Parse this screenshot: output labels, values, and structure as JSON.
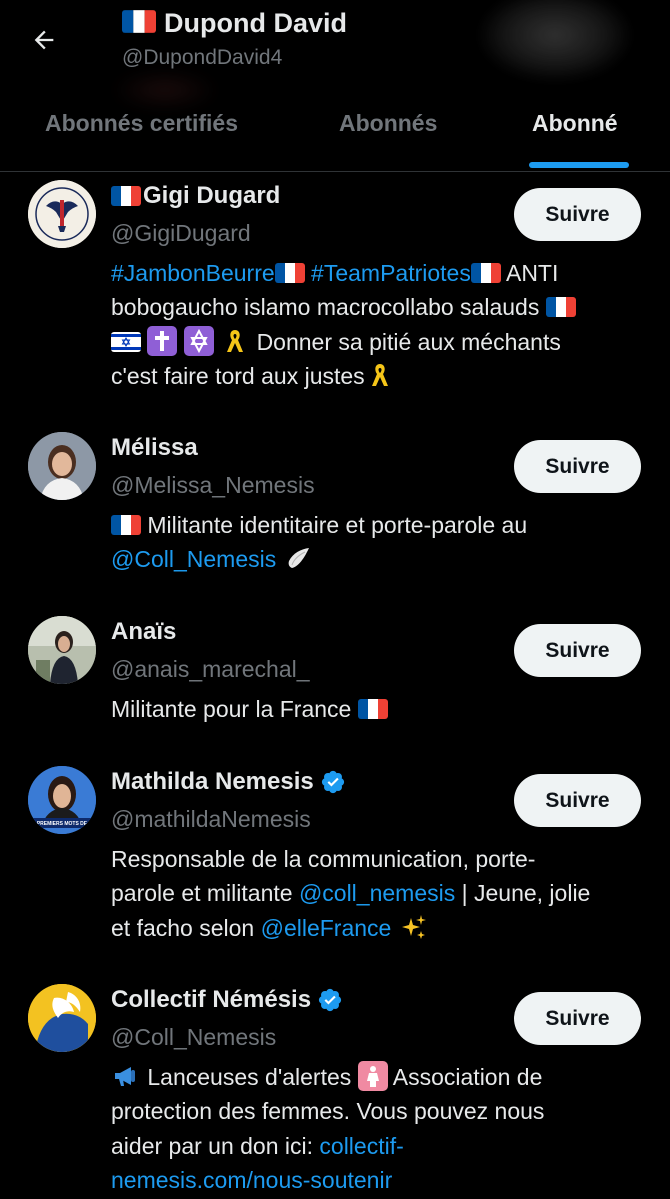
{
  "header": {
    "title": "Dupond David",
    "handle": "@DupondDavid4",
    "tabs": [
      {
        "label": "Abonnés certifiés",
        "active": false
      },
      {
        "label": "Abonnés",
        "active": false
      },
      {
        "label": "Abonné",
        "active": true
      }
    ]
  },
  "users": [
    {
      "name": "Gigi Dugard",
      "handle": "@GigiDugard",
      "follow_label": "Suivre",
      "bio": {
        "tag1": "#JambonBeurre",
        "tag2": "#TeamPatriotes",
        "text1": "ANTI",
        "text2": "bobogaucho islamo macrocollabo salauds",
        "text3": "Donner sa pitié aux méchants",
        "text4": "c'est faire tord aux justes"
      }
    },
    {
      "name": "Mélissa",
      "handle": "@Melissa_Nemesis",
      "follow_label": "Suivre",
      "bio": {
        "text1": "Militante identitaire et porte-parole au",
        "mention": "@Coll_Nemesis"
      }
    },
    {
      "name": "Anaïs",
      "handle": "@anais_marechal_",
      "follow_label": "Suivre",
      "bio": {
        "text1": "Militante pour la France"
      }
    },
    {
      "name": "Mathilda Nemesis",
      "handle": "@mathildaNemesis",
      "follow_label": "Suivre",
      "bio": {
        "text1": "Responsable de la communication, porte-",
        "text2": "parole et militante",
        "mention1": "@coll_nemesis",
        "text3": "| Jeune, jolie",
        "text4": "et facho selon",
        "mention2": "@elleFrance"
      }
    },
    {
      "name": "Collectif Némésis",
      "handle": "@Coll_Nemesis",
      "follow_label": "Suivre",
      "bio": {
        "text1": "Lanceuses d'alertes",
        "text2": "Association de",
        "text3": "protection des femmes. Vous pouvez nous",
        "text4": "aider par un don ici:",
        "link1": "collectif-",
        "link2": "nemesis.com/nous-soutenir"
      }
    }
  ],
  "avatars": [
    {
      "label": "PHARE PATRIOTE"
    },
    {
      "label": ""
    },
    {
      "label": ""
    },
    {
      "label": "PREMIERS MOTS DE"
    },
    {
      "label": ""
    }
  ],
  "colors": {
    "background": "#000000",
    "text": "#e7e9ea",
    "muted": "#71767b",
    "accent": "#1d9bf0",
    "button_bg": "#eff3f4",
    "button_text": "#0f1419"
  },
  "icons": {
    "back": "arrow-left-icon",
    "verified": "verified-badge-icon",
    "flag": "france-flag-icon"
  }
}
